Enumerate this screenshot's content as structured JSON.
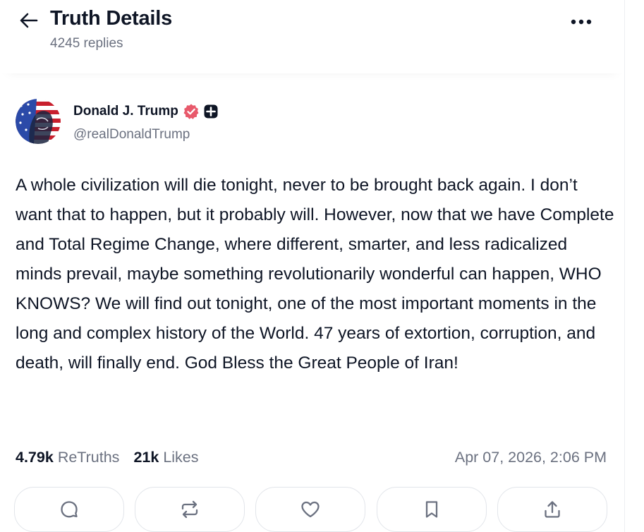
{
  "header": {
    "title": "Truth Details",
    "replies": "4245 replies"
  },
  "author": {
    "name": "Donald J. Trump",
    "handle": "@realDonaldTrump",
    "verified_color": "#e8596b"
  },
  "post": {
    "text": "A whole civilization will die tonight, never to be brought back again. I don’t want that to happen, but it probably will. However, now that we have Complete and Total Regime Change, where different, smarter, and less radicalized minds prevail, maybe something revolutionarily wonderful can happen, WHO KNOWS? We will find out tonight, one of the most important moments in the long and complex history of the World. 47 years of extortion, corruption, and death, will finally end. God Bless the Great People of Iran!",
    "retruths_count": "4.79k",
    "retruths_label": "ReTruths",
    "likes_count": "21k",
    "likes_label": "Likes",
    "timestamp": "Apr 07, 2026, 2:06 PM"
  },
  "actions": [
    {
      "icon": "reply-icon"
    },
    {
      "icon": "retruth-icon"
    },
    {
      "icon": "heart-icon"
    },
    {
      "icon": "bookmark-icon"
    },
    {
      "icon": "share-icon"
    }
  ],
  "colors": {
    "text_primary": "#0e1525",
    "text_secondary": "#6b7180",
    "border": "#e2e5ea"
  }
}
